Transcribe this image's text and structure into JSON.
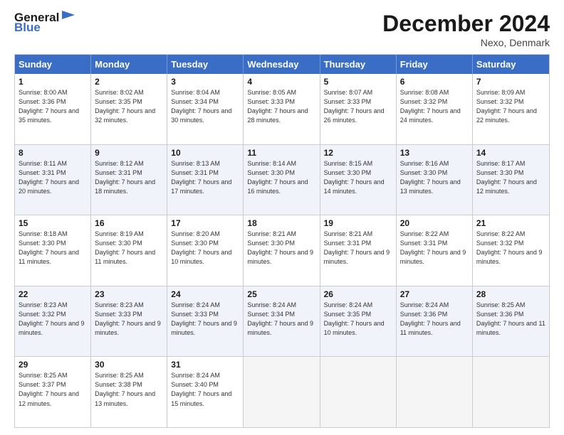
{
  "header": {
    "logo_general": "General",
    "logo_blue": "Blue",
    "month_title": "December 2024",
    "subtitle": "Nexo, Denmark"
  },
  "days_of_week": [
    "Sunday",
    "Monday",
    "Tuesday",
    "Wednesday",
    "Thursday",
    "Friday",
    "Saturday"
  ],
  "rows": [
    [
      {
        "day": "1",
        "sunrise": "8:00 AM",
        "sunset": "3:36 PM",
        "daylight": "7 hours and 35 minutes."
      },
      {
        "day": "2",
        "sunrise": "8:02 AM",
        "sunset": "3:35 PM",
        "daylight": "7 hours and 32 minutes."
      },
      {
        "day": "3",
        "sunrise": "8:04 AM",
        "sunset": "3:34 PM",
        "daylight": "7 hours and 30 minutes."
      },
      {
        "day": "4",
        "sunrise": "8:05 AM",
        "sunset": "3:33 PM",
        "daylight": "7 hours and 28 minutes."
      },
      {
        "day": "5",
        "sunrise": "8:07 AM",
        "sunset": "3:33 PM",
        "daylight": "7 hours and 26 minutes."
      },
      {
        "day": "6",
        "sunrise": "8:08 AM",
        "sunset": "3:32 PM",
        "daylight": "7 hours and 24 minutes."
      },
      {
        "day": "7",
        "sunrise": "8:09 AM",
        "sunset": "3:32 PM",
        "daylight": "7 hours and 22 minutes."
      }
    ],
    [
      {
        "day": "8",
        "sunrise": "8:11 AM",
        "sunset": "3:31 PM",
        "daylight": "7 hours and 20 minutes."
      },
      {
        "day": "9",
        "sunrise": "8:12 AM",
        "sunset": "3:31 PM",
        "daylight": "7 hours and 18 minutes."
      },
      {
        "day": "10",
        "sunrise": "8:13 AM",
        "sunset": "3:31 PM",
        "daylight": "7 hours and 17 minutes."
      },
      {
        "day": "11",
        "sunrise": "8:14 AM",
        "sunset": "3:30 PM",
        "daylight": "7 hours and 16 minutes."
      },
      {
        "day": "12",
        "sunrise": "8:15 AM",
        "sunset": "3:30 PM",
        "daylight": "7 hours and 14 minutes."
      },
      {
        "day": "13",
        "sunrise": "8:16 AM",
        "sunset": "3:30 PM",
        "daylight": "7 hours and 13 minutes."
      },
      {
        "day": "14",
        "sunrise": "8:17 AM",
        "sunset": "3:30 PM",
        "daylight": "7 hours and 12 minutes."
      }
    ],
    [
      {
        "day": "15",
        "sunrise": "8:18 AM",
        "sunset": "3:30 PM",
        "daylight": "7 hours and 11 minutes."
      },
      {
        "day": "16",
        "sunrise": "8:19 AM",
        "sunset": "3:30 PM",
        "daylight": "7 hours and 11 minutes."
      },
      {
        "day": "17",
        "sunrise": "8:20 AM",
        "sunset": "3:30 PM",
        "daylight": "7 hours and 10 minutes."
      },
      {
        "day": "18",
        "sunrise": "8:21 AM",
        "sunset": "3:30 PM",
        "daylight": "7 hours and 9 minutes."
      },
      {
        "day": "19",
        "sunrise": "8:21 AM",
        "sunset": "3:31 PM",
        "daylight": "7 hours and 9 minutes."
      },
      {
        "day": "20",
        "sunrise": "8:22 AM",
        "sunset": "3:31 PM",
        "daylight": "7 hours and 9 minutes."
      },
      {
        "day": "21",
        "sunrise": "8:22 AM",
        "sunset": "3:32 PM",
        "daylight": "7 hours and 9 minutes."
      }
    ],
    [
      {
        "day": "22",
        "sunrise": "8:23 AM",
        "sunset": "3:32 PM",
        "daylight": "7 hours and 9 minutes."
      },
      {
        "day": "23",
        "sunrise": "8:23 AM",
        "sunset": "3:33 PM",
        "daylight": "7 hours and 9 minutes."
      },
      {
        "day": "24",
        "sunrise": "8:24 AM",
        "sunset": "3:33 PM",
        "daylight": "7 hours and 9 minutes."
      },
      {
        "day": "25",
        "sunrise": "8:24 AM",
        "sunset": "3:34 PM",
        "daylight": "7 hours and 9 minutes."
      },
      {
        "day": "26",
        "sunrise": "8:24 AM",
        "sunset": "3:35 PM",
        "daylight": "7 hours and 10 minutes."
      },
      {
        "day": "27",
        "sunrise": "8:24 AM",
        "sunset": "3:36 PM",
        "daylight": "7 hours and 11 minutes."
      },
      {
        "day": "28",
        "sunrise": "8:25 AM",
        "sunset": "3:36 PM",
        "daylight": "7 hours and 11 minutes."
      }
    ],
    [
      {
        "day": "29",
        "sunrise": "8:25 AM",
        "sunset": "3:37 PM",
        "daylight": "7 hours and 12 minutes."
      },
      {
        "day": "30",
        "sunrise": "8:25 AM",
        "sunset": "3:38 PM",
        "daylight": "7 hours and 13 minutes."
      },
      {
        "day": "31",
        "sunrise": "8:24 AM",
        "sunset": "3:40 PM",
        "daylight": "7 hours and 15 minutes."
      },
      null,
      null,
      null,
      null
    ]
  ]
}
